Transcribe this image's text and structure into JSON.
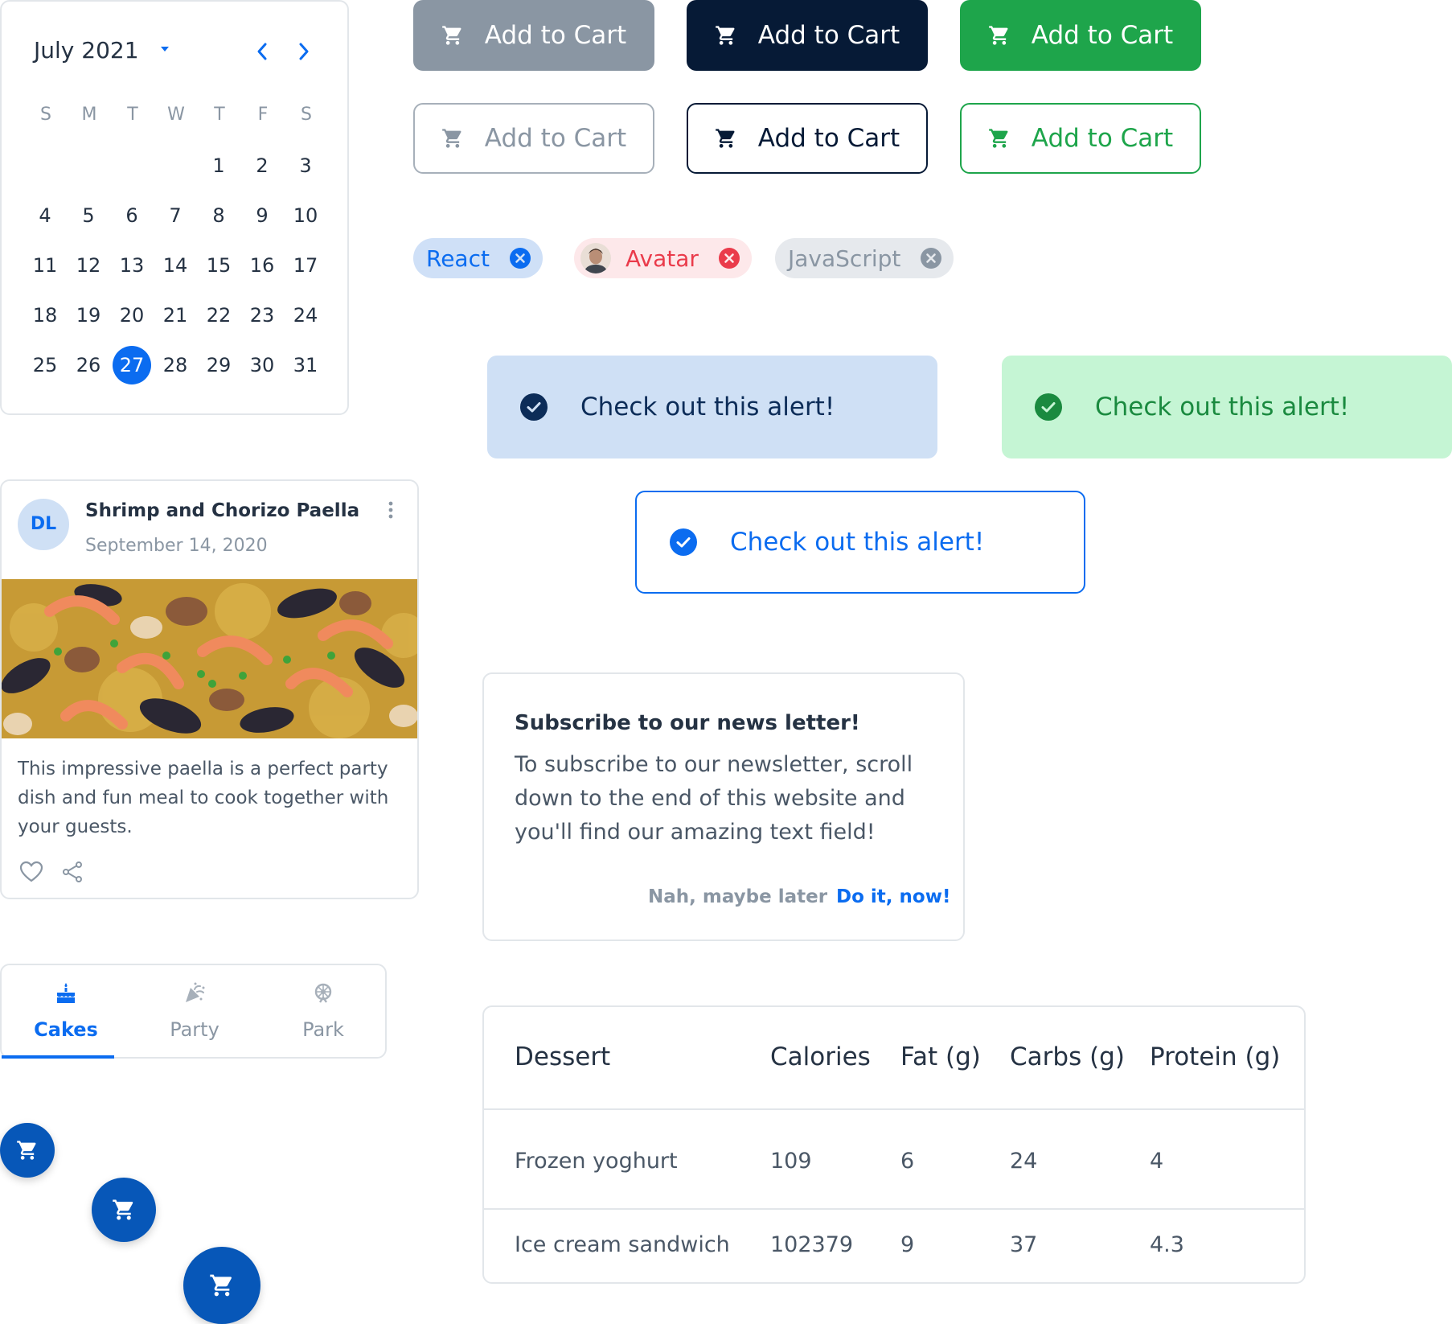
{
  "calendar": {
    "title": "July 2021",
    "weekdays": [
      "S",
      "M",
      "T",
      "W",
      "T",
      "F",
      "S"
    ],
    "days": [
      "1",
      "2",
      "3",
      "4",
      "5",
      "6",
      "7",
      "8",
      "9",
      "10",
      "11",
      "12",
      "13",
      "14",
      "15",
      "16",
      "17",
      "18",
      "19",
      "20",
      "21",
      "22",
      "23",
      "24",
      "25",
      "26",
      "27",
      "28",
      "29",
      "30",
      "31"
    ],
    "selected_day": "27",
    "accent": "#0b6cf0"
  },
  "buttons": {
    "row1": [
      "Add to Cart",
      "Add to Cart",
      "Add to Cart"
    ],
    "row2": [
      "Add to Cart",
      "Add to Cart",
      "Add to Cart"
    ],
    "icon": "cart-icon"
  },
  "chips": {
    "react": "React",
    "avatar": "Avatar",
    "javascript": "JavaScript"
  },
  "alerts": {
    "blue": "Check out this alert!",
    "green": "Check out this alert!",
    "outlined": "Check out this alert!",
    "icon": "check-circle-icon"
  },
  "recipe": {
    "avatar_initials": "DL",
    "title": "Shrimp and Chorizo Paella",
    "date": "September 14, 2020",
    "description": "This impressive paella is a perfect party dish and fun meal to cook together with your guests."
  },
  "tabs": [
    {
      "label": "Cakes",
      "icon": "cake-icon"
    },
    {
      "label": "Party",
      "icon": "party-icon"
    },
    {
      "label": "Park",
      "icon": "park-icon"
    }
  ],
  "dialog": {
    "title": "Subscribe to our news letter!",
    "body": "To subscribe to our newsletter, scroll down to the end of this website and you'll find our amazing text field!",
    "cancel": "Nah, maybe later",
    "confirm": "Do it, now!"
  },
  "table": {
    "headers": [
      "Dessert",
      "Calories",
      "Fat (g)",
      "Carbs (g)",
      "Protein (g)"
    ],
    "rows": [
      [
        "Frozen yoghurt",
        "109",
        "6",
        "24",
        "4"
      ],
      [
        "Ice cream sandwich",
        "102379",
        "9",
        "37",
        "4.3"
      ]
    ]
  },
  "colors": {
    "primary": "#0b6cf0",
    "navy": "#061a36",
    "green": "#1ea54b",
    "gray": "#8a96a3",
    "red": "#ea3b4b"
  }
}
